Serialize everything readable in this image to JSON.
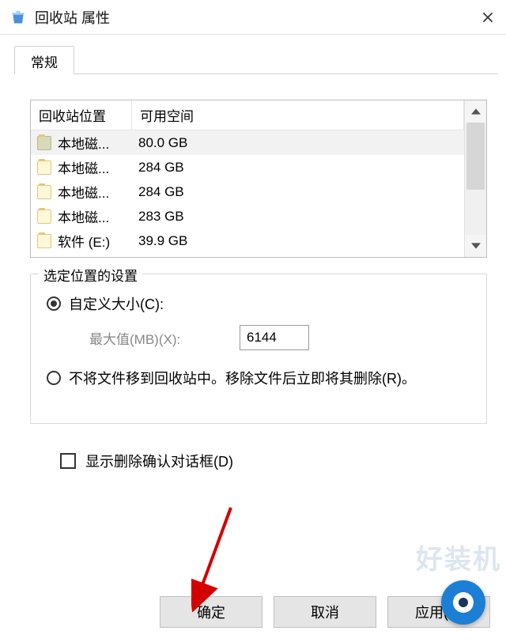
{
  "title": "回收站 属性",
  "tab": "常规",
  "columns": {
    "location": "回收站位置",
    "space": "可用空间"
  },
  "rows": [
    {
      "name": "本地磁...",
      "space": "80.0 GB",
      "selected": true
    },
    {
      "name": "本地磁...",
      "space": "284 GB"
    },
    {
      "name": "本地磁...",
      "space": "284 GB"
    },
    {
      "name": "本地磁...",
      "space": "283 GB"
    },
    {
      "name": "软件 (E:)",
      "space": "39.9 GB"
    }
  ],
  "group": {
    "title": "选定位置的设置",
    "custom_label": "自定义大小(C):",
    "max_label": "最大值(MB)(X):",
    "max_value": "6144",
    "nomove_label": "不将文件移到回收站中。移除文件后立即将其删除(R)。"
  },
  "confirm_label": "显示删除确认对话框(D)",
  "buttons": {
    "ok": "确定",
    "cancel": "取消",
    "apply": "应用(A)"
  },
  "watermark": "好装机"
}
